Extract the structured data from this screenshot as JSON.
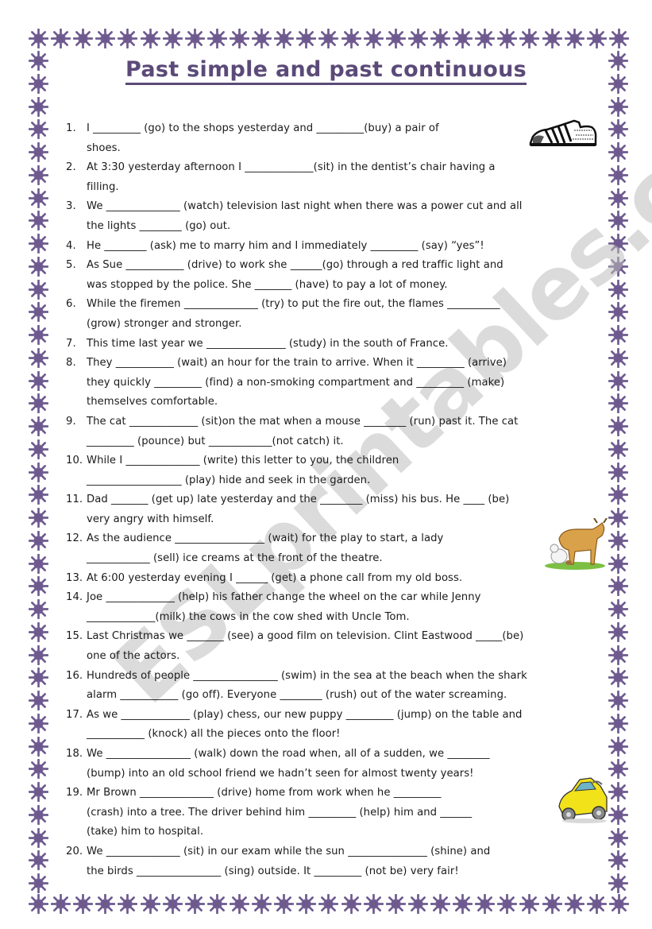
{
  "document": {
    "title": "Past simple and past continuous",
    "watermark": "ESLprintables.com",
    "accent_color": "#5b4a78",
    "border_color": "#6e5a8f",
    "border_icon": "asterisk-star-icon"
  },
  "exercises": [
    {
      "num": "1.",
      "text": "I _________ (go) to the shops yesterday and _________(buy) a pair of\nshoes."
    },
    {
      "num": "2.",
      "text": "At 3:30 yesterday afternoon I _____________(sit) in the dentist’s chair having a\nfilling."
    },
    {
      "num": "3.",
      "text": "We ______________ (watch) television last night when there was a power cut and all\nthe lights ________ (go) out."
    },
    {
      "num": "4.",
      "text": "He ________ (ask) me to marry him and I immediately _________ (say) “yes”!"
    },
    {
      "num": "5.",
      "text": "As Sue ___________ (drive) to work she ______(go) through a red traffic light and\nwas stopped by the police. She _______ (have) to pay a lot of money."
    },
    {
      "num": "6.",
      "text": "While the firemen ______________ (try) to put the fire out, the flames __________\n(grow) stronger and stronger."
    },
    {
      "num": "7.",
      "text": "This time last year we _______________ (study) in the south of France."
    },
    {
      "num": "8.",
      "text": "They ___________ (wait) an hour for the train to arrive. When it _________ (arrive)\nthey quickly _________ (find) a non-smoking compartment and _________ (make)\nthemselves comfortable."
    },
    {
      "num": "9.",
      "text": "The cat _____________ (sit)on the mat when a mouse ________ (run) past it. The cat\n_________ (pounce) but ____________(not catch) it."
    },
    {
      "num": "10.",
      "text": "While I ______________ (write) this letter to you, the children\n__________________ (play) hide and seek in the garden."
    },
    {
      "num": "11.",
      "text": "Dad _______ (get up) late yesterday and the ________ (miss) his bus. He ____ (be)\nvery angry with himself."
    },
    {
      "num": "12.",
      "text": "As the audience _________________ (wait) for the play to start, a lady\n____________ (sell) ice creams at the front of the theatre."
    },
    {
      "num": "13.",
      "text": "At 6:00 yesterday evening I ______ (get) a phone call from my old boss."
    },
    {
      "num": "14.",
      "text": "Joe _____________ (help) his father change the wheel on the car while Jenny\n_____________(milk) the cows in the cow shed with Uncle Tom."
    },
    {
      "num": "15.",
      "text": "Last Christmas we _______ (see) a good film on television. Clint Eastwood _____(be)\none of the actors."
    },
    {
      "num": "16.",
      "text": "Hundreds of people ________________ (swim) in the sea at the beach when the shark\nalarm ___________ (go off). Everyone ________ (rush) out of the water screaming."
    },
    {
      "num": "17.",
      "text": "As we _____________ (play) chess, our new puppy _________ (jump) on the table and\n___________ (knock) all the pieces onto the floor!"
    },
    {
      "num": "18.",
      "text": "We ________________ (walk) down the road when, all of a sudden, we ________\n(bump) into an old school friend we hadn’t seen for almost twenty years!"
    },
    {
      "num": "19.",
      "text": "Mr Brown ______________ (drive) home from work when he _________\n(crash) into a tree. The driver behind him _________ (help) him and ______\n(take) him to hospital."
    },
    {
      "num": "20.",
      "text": "We ______________ (sit) in our exam while the sun _______________ (shine) and\nthe birds ________________ (sing) outside. It _________ (not be) very fair!"
    }
  ],
  "illustrations": [
    {
      "name": "shoe-illustration",
      "near_item": "1."
    },
    {
      "name": "cow-illustration",
      "near_item": "12."
    },
    {
      "name": "car-illustration",
      "near_item": "19."
    }
  ]
}
